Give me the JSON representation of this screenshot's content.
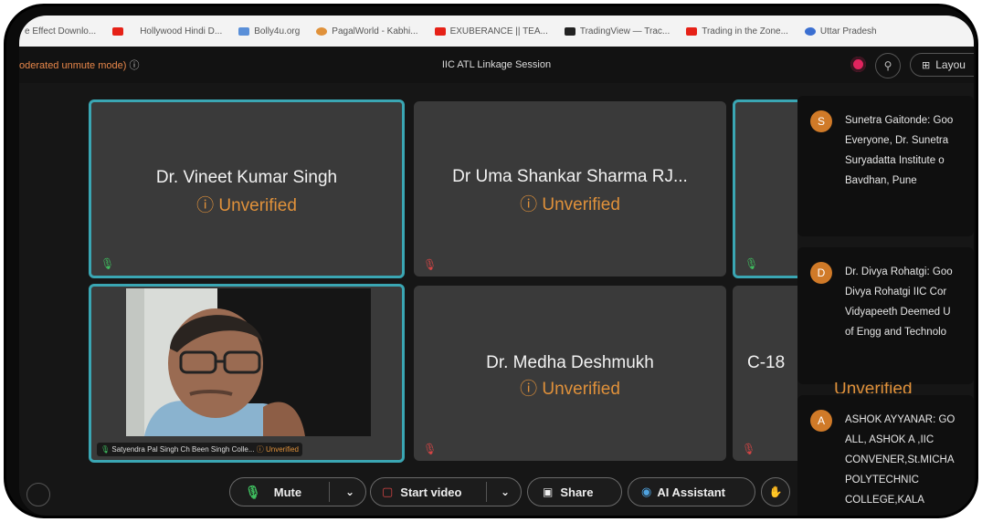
{
  "bookmarks": [
    {
      "label": "e Effect Downlo...",
      "icon": "bookmark-icon",
      "color": "#bbbbbb"
    },
    {
      "label": "",
      "icon": "youtube-icon",
      "color": "#e62117"
    },
    {
      "label": "Hollywood Hindi D...",
      "icon": "bookmark-icon",
      "color": "#dddddd"
    },
    {
      "label": "Bolly4u.org",
      "icon": "bookmark-icon",
      "color": "#5a8fd8"
    },
    {
      "label": "PagalWorld - Kabhi...",
      "icon": "bookmark-icon",
      "color": "#e0913a"
    },
    {
      "label": "EXUBERANCE || TEA...",
      "icon": "youtube-icon",
      "color": "#e62117"
    },
    {
      "label": "TradingView — Trac...",
      "icon": "tradingview-icon",
      "color": "#222222"
    },
    {
      "label": "Trading in the Zone...",
      "icon": "youtube-icon",
      "color": "#e62117"
    },
    {
      "label": "Uttar Pradesh",
      "icon": "globe-icon",
      "color": "#3b6fd1"
    }
  ],
  "meeting": {
    "mode_text": "oderated unmute mode)",
    "session_title": "IIC ATL Linkage Session",
    "layout_label": "Layou"
  },
  "participants": [
    {
      "name": "Dr. Vineet Kumar Singh",
      "status": "Unverified"
    },
    {
      "name": "Dr Uma Shankar Sharma RJ...",
      "status": "Unverified"
    },
    {
      "name": "Dr. Medha Deshmukh",
      "status": "Unverified"
    },
    {
      "name": "C-18",
      "status": ""
    },
    {
      "name": "Satyendra Pal Singh Ch Been Singh Colle...",
      "status": "Unverified"
    }
  ],
  "behind_panel_text": "Unverified",
  "chat": [
    {
      "avatar": "S",
      "text": "Sunetra Gaitonde: Goo\nEveryone, Dr. Sunetra\nSuryadatta Institute o\nBavdhan, Pune"
    },
    {
      "avatar": "D",
      "text": "Dr. Divya Rohatgi: Goo\nDivya Rohatgi IIC Cor\nVidyapeeth Deemed U\nof Engg and Technolo"
    },
    {
      "avatar": "A",
      "text": "ASHOK AYYANAR: GO\nALL, ASHOK A ,IIC\nCONVENER,St.MICHA\nPOLYTECHNIC\nCOLLEGE,KALA"
    }
  ],
  "controls": {
    "mute_label": "Mute",
    "video_label": "Start video",
    "share_label": "Share",
    "ai_label": "AI Assistant"
  },
  "colors": {
    "active_border": "#3aa6b3",
    "unverified": "#e0913a",
    "record": "#e0245e",
    "mic_green": "#3fbf5f",
    "mic_muted_red": "#d64545"
  }
}
